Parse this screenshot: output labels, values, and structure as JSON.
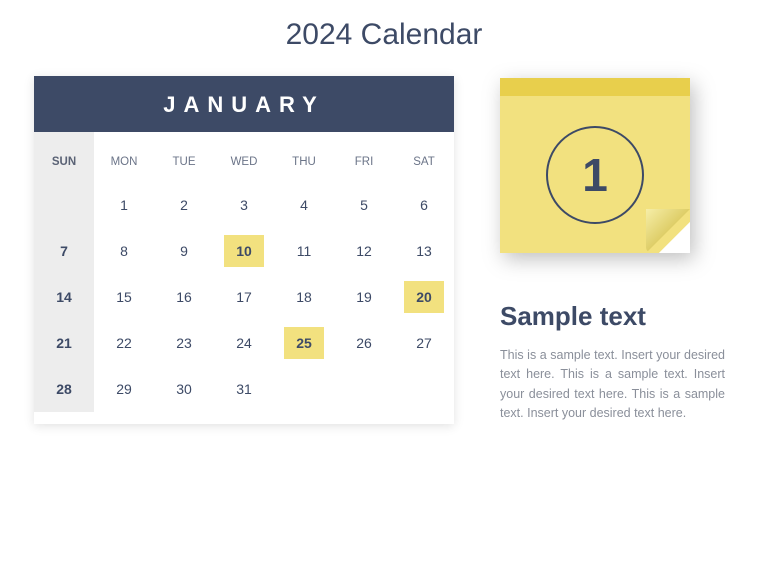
{
  "page": {
    "title": "2024 Calendar"
  },
  "calendar": {
    "month": "JANUARY",
    "dayHeaders": [
      "SUN",
      "MON",
      "TUE",
      "WED",
      "THU",
      "FRI",
      "SAT"
    ],
    "weeks": [
      [
        null,
        "1",
        "2",
        "3",
        "4",
        "5",
        "6"
      ],
      [
        "7",
        "8",
        "9",
        "10",
        "11",
        "12",
        "13"
      ],
      [
        "14",
        "15",
        "16",
        "17",
        "18",
        "19",
        "20"
      ],
      [
        "21",
        "22",
        "23",
        "24",
        "25",
        "26",
        "27"
      ],
      [
        "28",
        "29",
        "30",
        "31",
        null,
        null,
        null
      ]
    ],
    "highlighted": [
      "10",
      "20",
      "25"
    ]
  },
  "sticky": {
    "number": "1"
  },
  "sample": {
    "heading": "Sample text",
    "body": "This is a sample text. Insert your desired text here. This is a sample text. Insert your desired text here. This is a sample text. Insert your desired text here."
  }
}
